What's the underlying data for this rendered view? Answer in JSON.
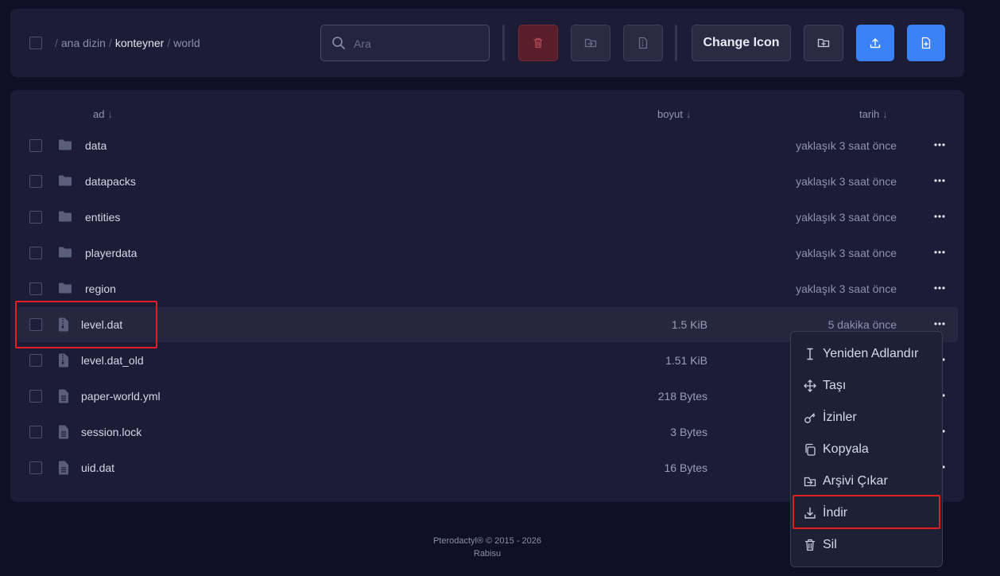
{
  "breadcrumb": {
    "parts": [
      "ana dizin",
      "konteyner",
      "world"
    ]
  },
  "search": {
    "placeholder": "Ara"
  },
  "toolbar": {
    "change_icon_label": "Change Icon"
  },
  "columns": {
    "name": "ad",
    "size": "boyut",
    "date": "tarih",
    "sort_arrow": "↓"
  },
  "rows": [
    {
      "name": "data",
      "type": "folder",
      "size": "",
      "date": "yaklaşık 3 saat önce"
    },
    {
      "name": "datapacks",
      "type": "folder",
      "size": "",
      "date": "yaklaşık 3 saat önce"
    },
    {
      "name": "entities",
      "type": "folder",
      "size": "",
      "date": "yaklaşık 3 saat önce"
    },
    {
      "name": "playerdata",
      "type": "folder",
      "size": "",
      "date": "yaklaşık 3 saat önce"
    },
    {
      "name": "region",
      "type": "folder",
      "size": "",
      "date": "yaklaşık 3 saat önce"
    },
    {
      "name": "level.dat",
      "type": "archive",
      "size": "1.5 KiB",
      "date": "5 dakika önce"
    },
    {
      "name": "level.dat_old",
      "type": "archive",
      "size": "1.51 KiB",
      "date": ""
    },
    {
      "name": "paper-world.yml",
      "type": "file",
      "size": "218 Bytes",
      "date": ""
    },
    {
      "name": "session.lock",
      "type": "file",
      "size": "3 Bytes",
      "date": ""
    },
    {
      "name": "uid.dat",
      "type": "file",
      "size": "16 Bytes",
      "date": ""
    }
  ],
  "context_menu": {
    "items": [
      {
        "label": "Yeniden Adlandır",
        "icon": "rename-icon"
      },
      {
        "label": "Taşı",
        "icon": "move-icon"
      },
      {
        "label": "İzinler",
        "icon": "key-icon"
      },
      {
        "label": "Kopyala",
        "icon": "copy-icon"
      },
      {
        "label": "Arşivi Çıkar",
        "icon": "folder-open-icon"
      },
      {
        "label": "İndir",
        "icon": "download-icon"
      },
      {
        "label": "Sil",
        "icon": "trash-icon"
      }
    ]
  },
  "footer": {
    "line1": "Pterodactyl® © 2015 - 2026",
    "line2": "Rabisu"
  },
  "colors": {
    "background": "#0f0f26",
    "panel": "#1c1c36",
    "accent_blue": "#3b82f6",
    "danger": "#5a1e2a",
    "highlight_box": "#e02020"
  }
}
